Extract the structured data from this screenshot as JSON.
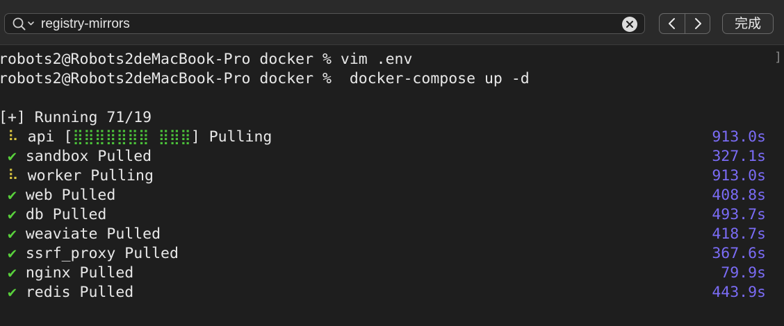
{
  "find_bar": {
    "query": "registry-mirrors",
    "done_label": "完成",
    "icons": [
      "search-icon",
      "clear-icon",
      "chevron-left-icon",
      "chevron-right-icon"
    ]
  },
  "terminal": {
    "prompt_lines": [
      "robots2@Robots2deMacBook-Pro docker % vim .env",
      "robots2@Robots2deMacBook-Pro docker %  docker-compose up -d"
    ],
    "status": "[+] Running 71/19",
    "services": [
      {
        "marker": "⠧",
        "name": "api",
        "progress": "[⣿⣿⣿⣿⣿⣿⣿ ⣿⣿⣿]",
        "state": "Pulling",
        "time": "913.0s"
      },
      {
        "marker": "✔",
        "name": "sandbox",
        "progress": "",
        "state": "Pulled",
        "time": "327.1s"
      },
      {
        "marker": "⠧",
        "name": "worker",
        "progress": "",
        "state": "Pulling",
        "time": "913.0s"
      },
      {
        "marker": "✔",
        "name": "web",
        "progress": "",
        "state": "Pulled",
        "time": "408.8s"
      },
      {
        "marker": "✔",
        "name": "db",
        "progress": "",
        "state": "Pulled",
        "time": "493.7s"
      },
      {
        "marker": "✔",
        "name": "weaviate",
        "progress": "",
        "state": "Pulled",
        "time": "418.7s"
      },
      {
        "marker": "✔",
        "name": "ssrf_proxy",
        "progress": "",
        "state": "Pulled",
        "time": "367.6s"
      },
      {
        "marker": "✔",
        "name": "nginx",
        "progress": "",
        "state": "Pulled",
        "time": "79.9s"
      },
      {
        "marker": "✔",
        "name": "redis",
        "progress": "",
        "state": "Pulled",
        "time": "443.9s"
      }
    ],
    "colors": {
      "check": "#59d13c",
      "spinner": "#d9c440",
      "progress_bar": "#4cc23a",
      "timer": "#7b6cf6",
      "background": "#1e1e1e",
      "text": "#e8e8e8"
    }
  }
}
